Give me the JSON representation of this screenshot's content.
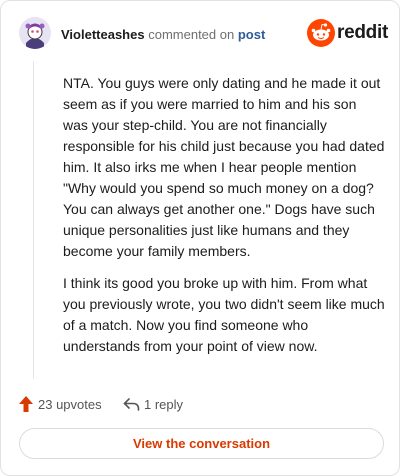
{
  "header": {
    "username": "Violetteashes",
    "action_text": "commented on",
    "post_link": "post",
    "brand": "reddit"
  },
  "comment": {
    "paragraphs": [
      "NTA. You guys were only dating and he made it out seem as if you were married to him and his son was your step-child. You are not financially responsible for his child just because you had dated him. It also irks me when I hear people mention \"Why would you spend so much money on a dog? You can always get another one.\" Dogs have such unique personalities just like humans and they become your family members.",
      "I think its good you broke up with him. From what you previously wrote, you two didn't seem like much of a match. Now you find someone who understands from your point of view now."
    ]
  },
  "footer": {
    "upvotes": "23 upvotes",
    "replies": "1 reply"
  },
  "cta": {
    "label": "View the conversation"
  },
  "colors": {
    "brand_orange": "#ff4500",
    "upvote_orange": "#d93a00",
    "link_blue": "#2f5b9a",
    "muted_text": "#6f6f6f"
  },
  "icons": {
    "avatar": "snoo-avatar",
    "logo": "reddit-snoo-icon",
    "upvote": "upvote-arrow-icon",
    "reply": "reply-arrow-icon"
  }
}
